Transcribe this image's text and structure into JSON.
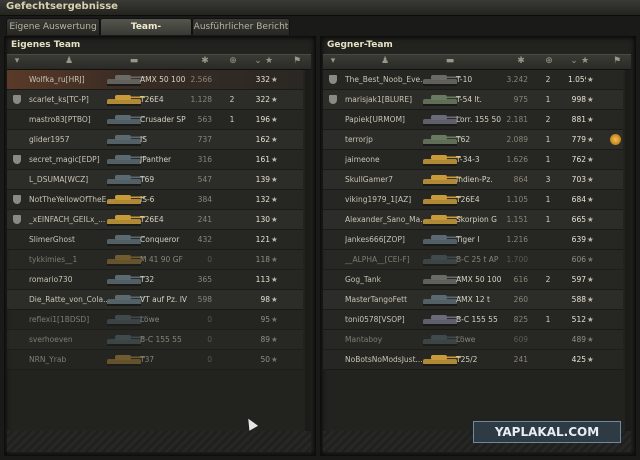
{
  "window": {
    "title": "Gefechtsergebnisse"
  },
  "tabs": [
    {
      "label": "Eigene Auswertung",
      "active": false
    },
    {
      "label": "Team-Auswertung",
      "active": true
    },
    {
      "label": "Ausführlicher Bericht",
      "active": false
    }
  ],
  "own_team": {
    "title": "Eigenes Team",
    "rows": [
      {
        "player": "Wolfka_ru[HRJ]",
        "tank": "AMX 50 100",
        "damage": "2.566",
        "kills": "",
        "xp": "332",
        "clan": false,
        "self": true,
        "dead": false,
        "tank_color": "#6a6a66"
      },
      {
        "player": "scarlet_ks[TC-P]",
        "tank": "T26E4",
        "damage": "1.128",
        "kills": "2",
        "xp": "322",
        "clan": true,
        "self": false,
        "dead": false,
        "tank_color": "#c89a3a"
      },
      {
        "player": "mastro83[PTBO]",
        "tank": "Crusader SP",
        "damage": "563",
        "kills": "1",
        "xp": "196",
        "clan": false,
        "self": false,
        "dead": false,
        "tank_color": "#5a6a70"
      },
      {
        "player": "glider1957",
        "tank": "IS",
        "damage": "737",
        "kills": "",
        "xp": "162",
        "clan": false,
        "self": false,
        "dead": false,
        "tank_color": "#5a6a70"
      },
      {
        "player": "secret_magic[EDP]",
        "tank": "JPanther",
        "damage": "316",
        "kills": "",
        "xp": "161",
        "clan": true,
        "self": false,
        "dead": false,
        "tank_color": "#5a6a70"
      },
      {
        "player": "L_DSUMA[WCZ]",
        "tank": "T69",
        "damage": "547",
        "kills": "",
        "xp": "139",
        "clan": false,
        "self": false,
        "dead": false,
        "tank_color": "#5a6a70"
      },
      {
        "player": "NotTheYellowOfTheE...",
        "tank": "IS-6",
        "damage": "384",
        "kills": "",
        "xp": "132",
        "clan": true,
        "self": false,
        "dead": false,
        "tank_color": "#c89a3a"
      },
      {
        "player": "_xEINFACH_GEILx_...",
        "tank": "T26E4",
        "damage": "241",
        "kills": "",
        "xp": "130",
        "clan": true,
        "self": false,
        "dead": false,
        "tank_color": "#c89a3a"
      },
      {
        "player": "SlimerGhost",
        "tank": "Conqueror",
        "damage": "432",
        "kills": "",
        "xp": "121",
        "clan": false,
        "self": false,
        "dead": false,
        "tank_color": "#5a6a70"
      },
      {
        "player": "tykkimies__1",
        "tank": "M 41 90 GF",
        "damage": "0",
        "kills": "",
        "xp": "118",
        "clan": false,
        "self": false,
        "dead": true,
        "tank_color": "#b08a40"
      },
      {
        "player": "romario730",
        "tank": "T32",
        "damage": "365",
        "kills": "",
        "xp": "113",
        "clan": false,
        "self": false,
        "dead": false,
        "tank_color": "#5a6a70"
      },
      {
        "player": "Die_Ratte_von_Cola...",
        "tank": "VT auf Pz. IV",
        "damage": "598",
        "kills": "",
        "xp": "98",
        "clan": false,
        "self": false,
        "dead": false,
        "tank_color": "#5a6a70"
      },
      {
        "player": "reflexi1[1BDSD]",
        "tank": "Löwe",
        "damage": "0",
        "kills": "",
        "xp": "95",
        "clan": false,
        "self": false,
        "dead": true,
        "tank_color": "#5a6a70"
      },
      {
        "player": "sverhoeven",
        "tank": "B-C 155 55",
        "damage": "0",
        "kills": "",
        "xp": "89",
        "clan": false,
        "self": false,
        "dead": true,
        "tank_color": "#5a6a70"
      },
      {
        "player": "NRN_Yrab",
        "tank": "T37",
        "damage": "0",
        "kills": "",
        "xp": "50",
        "clan": false,
        "self": false,
        "dead": true,
        "tank_color": "#b08a40"
      }
    ]
  },
  "enemy_team": {
    "title": "Gegner-Team",
    "rows": [
      {
        "player": "The_Best_Noob_Eve...",
        "tank": "T-10",
        "damage": "3.242",
        "kills": "2",
        "xp": "1.059",
        "clan": true,
        "medal": false,
        "dead": false,
        "tank_color": "#6a6a66"
      },
      {
        "player": "marisjak1[BLURE]",
        "tank": "T-54 lt.",
        "damage": "975",
        "kills": "1",
        "xp": "998",
        "clan": true,
        "medal": false,
        "dead": false,
        "tank_color": "#6a7a60"
      },
      {
        "player": "Papiek[URMOM]",
        "tank": "Lorr. 155 50",
        "damage": "2.181",
        "kills": "2",
        "xp": "881",
        "clan": false,
        "medal": false,
        "dead": false,
        "tank_color": "#6a6a78"
      },
      {
        "player": "terrorjp",
        "tank": "T62",
        "damage": "2.089",
        "kills": "1",
        "xp": "779",
        "clan": false,
        "medal": true,
        "dead": false,
        "tank_color": "#6a7a60"
      },
      {
        "player": "jaimeone",
        "tank": "T-34-3",
        "damage": "1.626",
        "kills": "1",
        "xp": "762",
        "clan": false,
        "medal": false,
        "dead": false,
        "tank_color": "#c89a3a"
      },
      {
        "player": "SkullGamer7",
        "tank": "Indien-Pz.",
        "damage": "864",
        "kills": "3",
        "xp": "703",
        "clan": false,
        "medal": false,
        "dead": false,
        "tank_color": "#c89a3a"
      },
      {
        "player": "viking1979_1[AZ]",
        "tank": "T26E4",
        "damage": "1.105",
        "kills": "1",
        "xp": "684",
        "clan": false,
        "medal": false,
        "dead": false,
        "tank_color": "#c89a3a"
      },
      {
        "player": "Alexander_Sano_Ma...",
        "tank": "Skorpion G",
        "damage": "1.151",
        "kills": "1",
        "xp": "665",
        "clan": false,
        "medal": false,
        "dead": false,
        "tank_color": "#c89a3a"
      },
      {
        "player": "Jankes666[ZOP]",
        "tank": "Tiger I",
        "damage": "1.216",
        "kills": "",
        "xp": "639",
        "clan": false,
        "medal": false,
        "dead": false,
        "tank_color": "#5a6a70"
      },
      {
        "player": "__ALPHA__[CEI-F]",
        "tank": "B-C 25 t AP",
        "damage": "1.700",
        "kills": "",
        "xp": "606",
        "clan": false,
        "medal": false,
        "dead": true,
        "tank_color": "#5a6a70"
      },
      {
        "player": "Gog_Tank",
        "tank": "AMX 50 100",
        "damage": "616",
        "kills": "2",
        "xp": "597",
        "clan": false,
        "medal": false,
        "dead": false,
        "tank_color": "#6a6a66"
      },
      {
        "player": "MasterTangoFett",
        "tank": "AMX 12 t",
        "damage": "260",
        "kills": "",
        "xp": "588",
        "clan": false,
        "medal": false,
        "dead": false,
        "tank_color": "#5a6a70"
      },
      {
        "player": "toni0578[VSOP]",
        "tank": "B-C 155 55",
        "damage": "825",
        "kills": "1",
        "xp": "512",
        "clan": false,
        "medal": false,
        "dead": false,
        "tank_color": "#6a6a78"
      },
      {
        "player": "Mantaboy",
        "tank": "Löwe",
        "damage": "609",
        "kills": "",
        "xp": "489",
        "clan": false,
        "medal": false,
        "dead": true,
        "tank_color": "#5a6a70"
      },
      {
        "player": "NoBotsNoModsJust...",
        "tank": "T25/2",
        "damage": "241",
        "kills": "",
        "xp": "425",
        "clan": false,
        "medal": false,
        "dead": false,
        "tank_color": "#c89a3a"
      }
    ]
  },
  "watermark": "YAPLAKAL.COM",
  "icons": {
    "xp": "star-icon",
    "clan": "shield-icon",
    "medal": "medal-icon"
  }
}
